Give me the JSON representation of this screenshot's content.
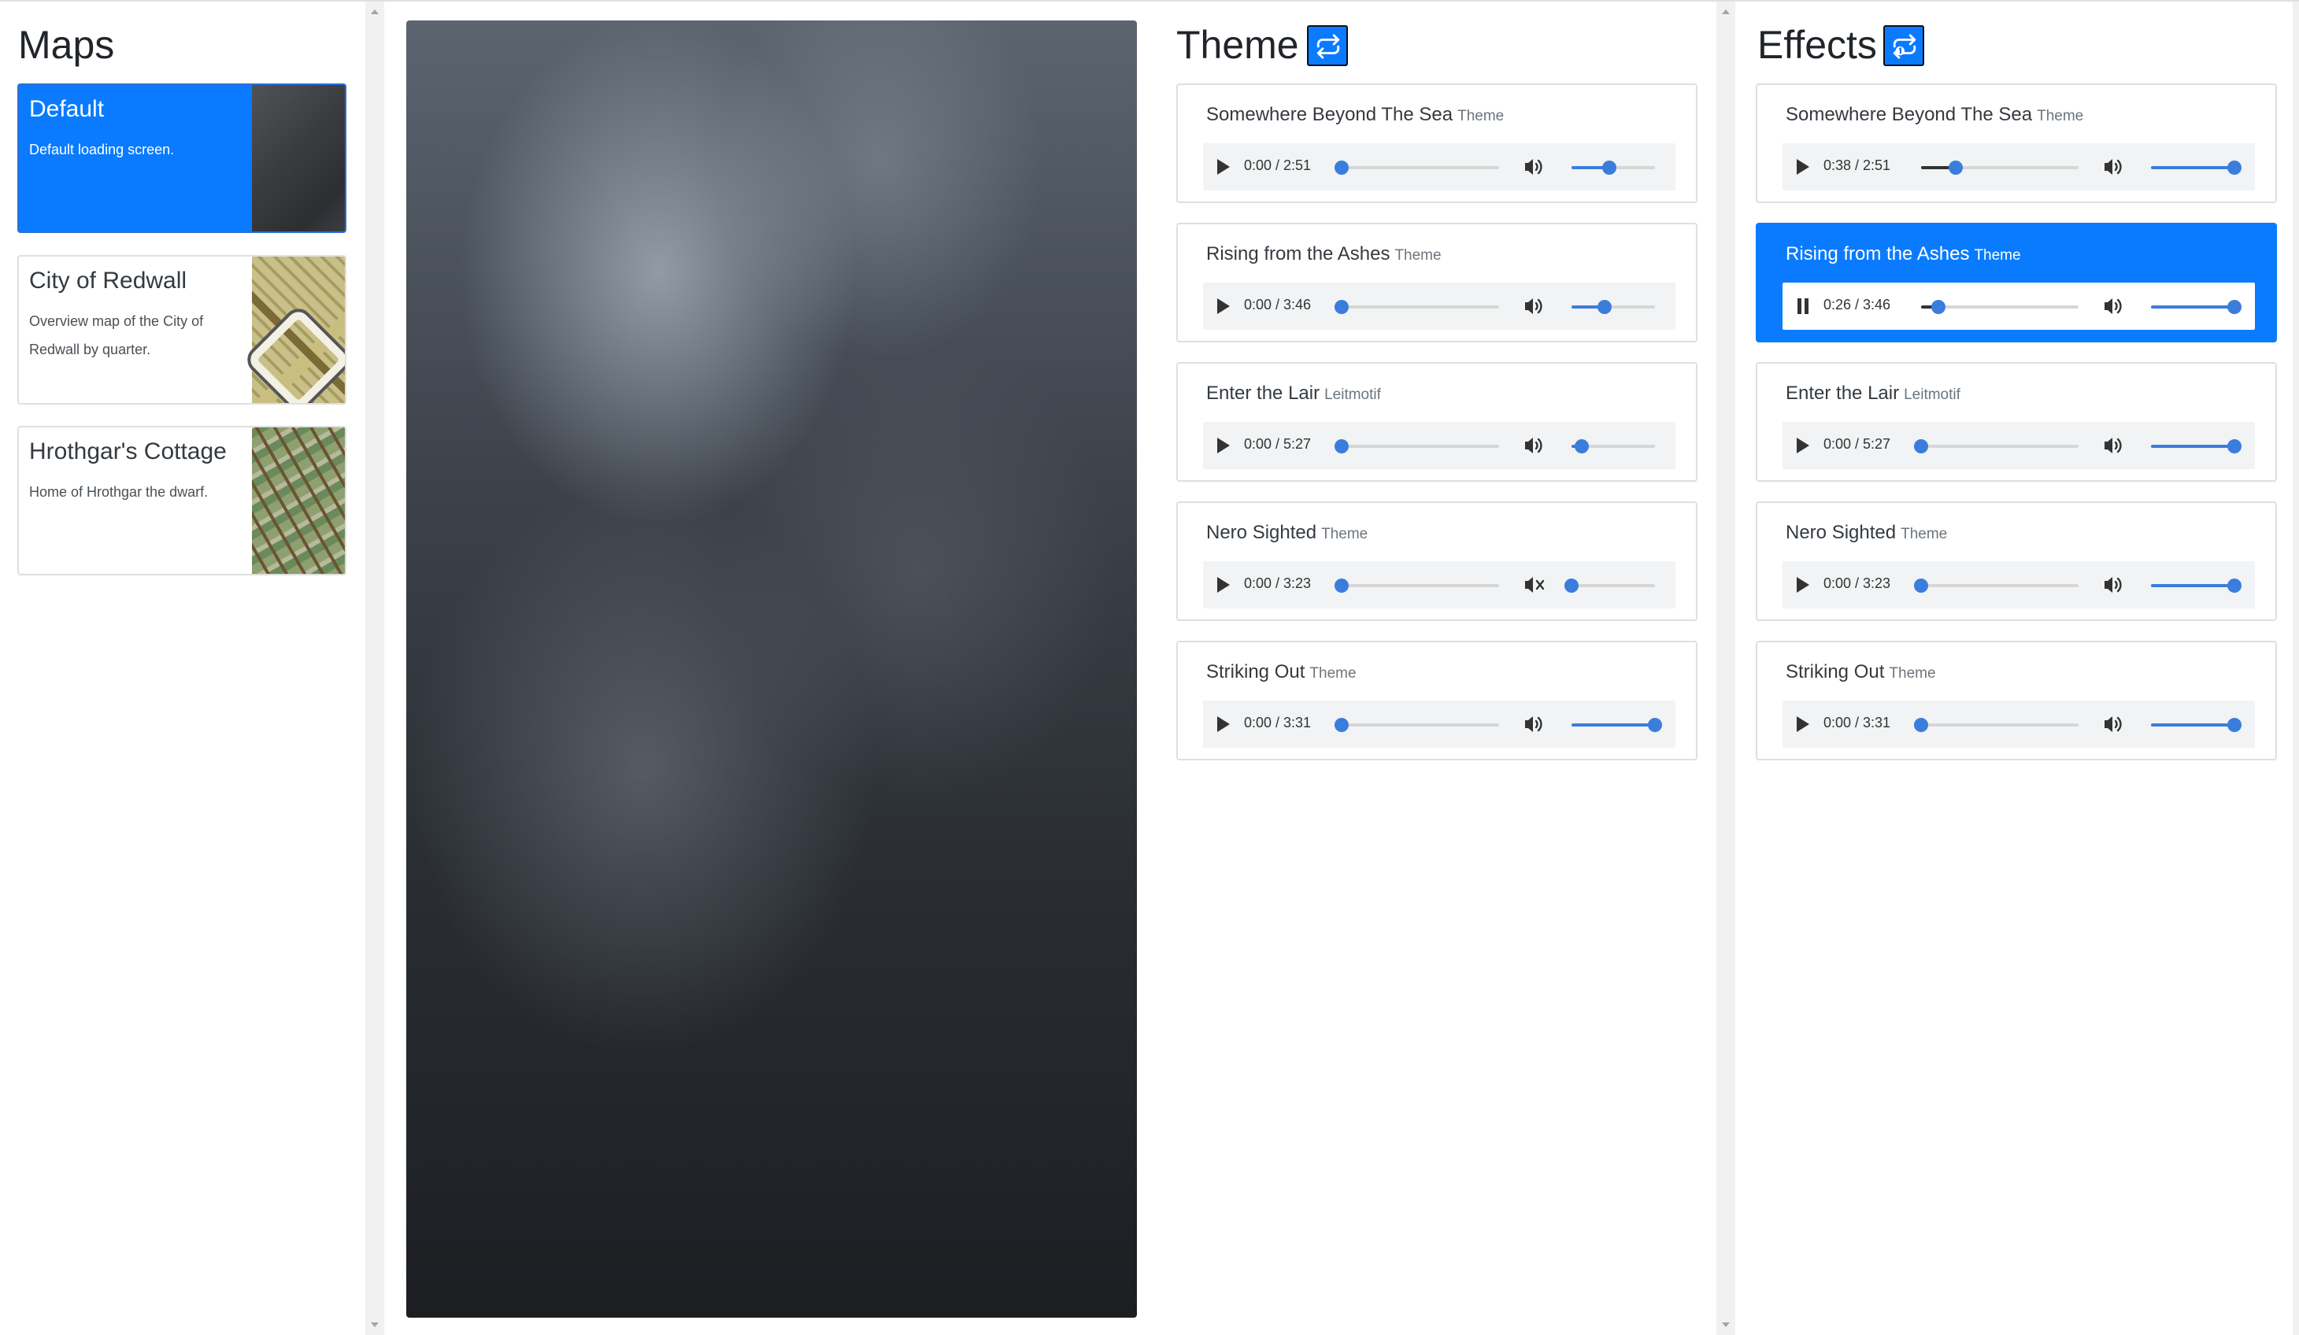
{
  "maps": {
    "title": "Maps",
    "items": [
      {
        "title": "Default",
        "description": "Default loading screen.",
        "active": true,
        "thumb": "smoke-thumbnail"
      },
      {
        "title": "City of Redwall",
        "description": "Overview map of the City of Redwall by quarter.",
        "active": false,
        "thumb": "city-map-thumbnail"
      },
      {
        "title": "Hrothgar's Cottage",
        "description": "Home of Hrothgar the dwarf.",
        "active": false,
        "thumb": "cottage-map-thumbnail"
      }
    ]
  },
  "theme": {
    "title": "Theme",
    "loop_icon": "repeat-icon",
    "tracks": [
      {
        "name": "Somewhere Beyond The Sea",
        "type": "Theme",
        "time": "0:00 / 2:51",
        "progress": 0,
        "volume": 0.45,
        "muted": false,
        "playing": false
      },
      {
        "name": "Rising from the Ashes",
        "type": "Theme",
        "time": "0:00 / 3:46",
        "progress": 0,
        "volume": 0.4,
        "muted": false,
        "playing": false
      },
      {
        "name": "Enter the Lair",
        "type": "Leitmotif",
        "time": "0:00 / 5:27",
        "progress": 0,
        "volume": 0.12,
        "muted": false,
        "playing": false
      },
      {
        "name": "Nero Sighted",
        "type": "Theme",
        "time": "0:00 / 3:23",
        "progress": 0,
        "volume": 0.0,
        "muted": true,
        "playing": false
      },
      {
        "name": "Striking Out",
        "type": "Theme",
        "time": "0:00 / 3:31",
        "progress": 0,
        "volume": 1.0,
        "muted": false,
        "playing": false
      }
    ]
  },
  "effects": {
    "title": "Effects",
    "loop_icon": "repeat-one-icon",
    "tracks": [
      {
        "name": "Somewhere Beyond The Sea",
        "type": "Theme",
        "time": "0:38 / 2:51",
        "progress": 0.22,
        "volume": 1.0,
        "muted": false,
        "playing": false,
        "active": false
      },
      {
        "name": "Rising from the Ashes",
        "type": "Theme",
        "time": "0:26 / 3:46",
        "progress": 0.11,
        "volume": 1.0,
        "muted": false,
        "playing": true,
        "active": true
      },
      {
        "name": "Enter the Lair",
        "type": "Leitmotif",
        "time": "0:00 / 5:27",
        "progress": 0,
        "volume": 1.0,
        "muted": false,
        "playing": false,
        "active": false
      },
      {
        "name": "Nero Sighted",
        "type": "Theme",
        "time": "0:00 / 3:23",
        "progress": 0,
        "volume": 1.0,
        "muted": false,
        "playing": false,
        "active": false
      },
      {
        "name": "Striking Out",
        "type": "Theme",
        "time": "0:00 / 3:31",
        "progress": 0,
        "volume": 1.0,
        "muted": false,
        "playing": false,
        "active": false
      }
    ]
  },
  "colors": {
    "accent": "#0a7bff",
    "slider": "#3b7ddd"
  }
}
